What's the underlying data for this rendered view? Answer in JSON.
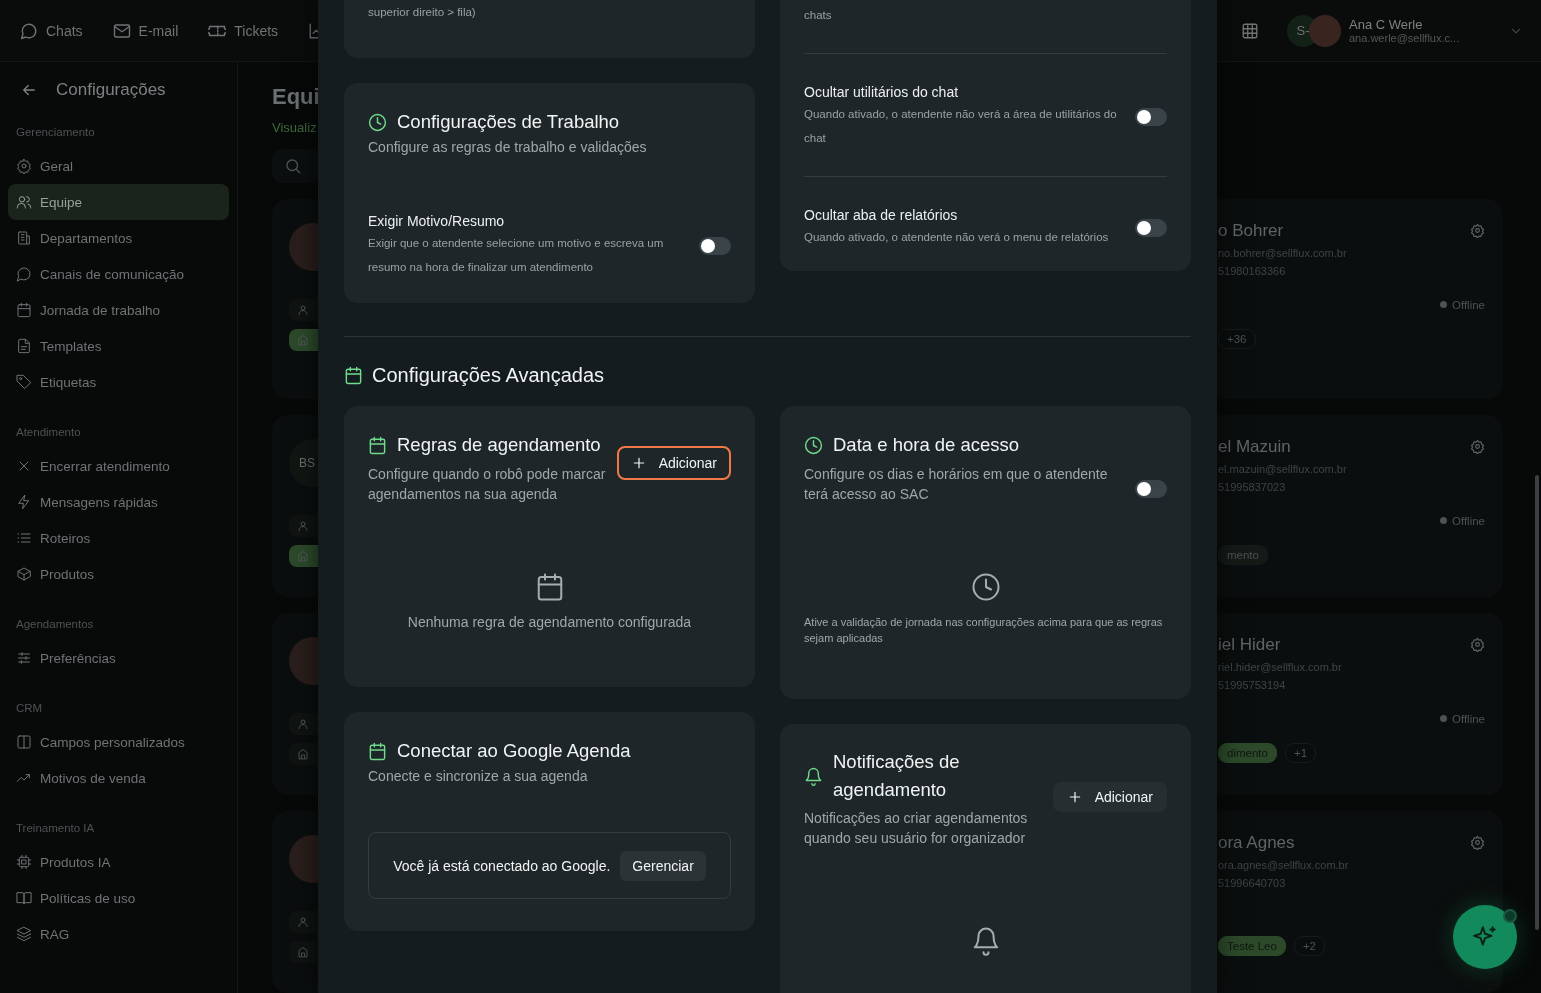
{
  "top_nav": [
    {
      "label": "Chats"
    },
    {
      "label": "E-mail"
    },
    {
      "label": "Tickets"
    }
  ],
  "account": {
    "initials": "S-",
    "name": "Ana C Werle",
    "email": "ana.werle@sellflux.c..."
  },
  "sidebar": {
    "title": "Configurações",
    "sections": [
      {
        "heading": "Gerenciamento",
        "items": [
          {
            "label": "Geral",
            "selected": false
          },
          {
            "label": "Equipe",
            "selected": true
          },
          {
            "label": "Departamentos",
            "selected": false
          },
          {
            "label": "Canais de comunicação",
            "selected": false
          },
          {
            "label": "Jornada de trabalho",
            "selected": false
          },
          {
            "label": "Templates",
            "selected": false
          },
          {
            "label": "Etiquetas",
            "selected": false
          }
        ]
      },
      {
        "heading": "Atendimento",
        "items": [
          {
            "label": "Encerrar atendimento",
            "selected": false
          },
          {
            "label": "Mensagens rápidas",
            "selected": false
          },
          {
            "label": "Roteiros",
            "selected": false
          },
          {
            "label": "Produtos",
            "selected": false
          }
        ]
      },
      {
        "heading": "Agendamentos",
        "items": [
          {
            "label": "Preferências",
            "selected": false
          }
        ]
      },
      {
        "heading": "CRM",
        "items": [
          {
            "label": "Campos personalizados",
            "selected": false
          },
          {
            "label": "Motivos de venda",
            "selected": false
          }
        ]
      },
      {
        "heading": "Treinamento IA",
        "items": [
          {
            "label": "Produtos IA",
            "selected": false
          },
          {
            "label": "Políticas de uso",
            "selected": false
          },
          {
            "label": "RAG",
            "selected": false
          }
        ]
      }
    ]
  },
  "page": {
    "title": "Equi",
    "subtitle": "Visualiz"
  },
  "team_cards_left": [
    {
      "kind": "photo",
      "chip": {
        "color": "#2c4a2a"
      }
    },
    {
      "kind": "initials",
      "initials": "BS",
      "chip": {
        "color": "#2c4a2a"
      }
    },
    {
      "kind": "photo",
      "chip": {
        "color": "#0f1312"
      }
    },
    {
      "kind": "photo",
      "chip": {
        "color": "#0f1312"
      }
    }
  ],
  "team_cards_right": [
    {
      "name": "o Bohrer",
      "email": "no.bohrer@sellflux.com.br",
      "phone": "51980163366",
      "status": "Offline",
      "tags": [
        {
          "label": "+36",
          "kind": "plain"
        }
      ]
    },
    {
      "name": "el Mazuin",
      "email": "el.mazuin@sellflux.com.br",
      "phone": "51995837023",
      "status": "Offline",
      "tags": [
        {
          "label": "mento",
          "kind": "muted"
        }
      ]
    },
    {
      "name": "iel Hider",
      "email": "riel.hider@sellflux.com.br",
      "phone": "51995753194",
      "status": "Offline",
      "tags": [
        {
          "label": "dimento",
          "kind": "highlight"
        },
        {
          "label": "+1",
          "kind": "plain"
        }
      ]
    },
    {
      "name": "ora Agnes",
      "email": "ora.agnes@sellflux.com.br",
      "phone": "51996640703",
      "tags": [
        {
          "label": "Teste Leo",
          "kind": "highlight"
        },
        {
          "label": "+2",
          "kind": "plain"
        }
      ]
    }
  ],
  "modal": {
    "fragment_left": "superior direito > fila)",
    "fragment_right": "chats",
    "right_settings": [
      {
        "title": "Ocultar utilitários do chat",
        "description": "Quando ativado, o atendente não verá a área de utilitários do chat",
        "on": false
      },
      {
        "title": "Ocultar aba de relatórios",
        "description": "Quando ativado, o atendente não verá o menu de relatórios",
        "on": false
      }
    ],
    "work": {
      "title": "Configurações de Trabalho",
      "subtitle": "Configure as regras de trabalho e validações",
      "settings": [
        {
          "title": "Exigir Motivo/Resumo",
          "description": "Exigir que o atendente selecione um motivo e escreva um resumo na hora de finalizar um atendimento",
          "on": false
        }
      ]
    },
    "advanced": {
      "title": "Configurações Avançadas",
      "rules": {
        "title": "Regras de agendamento",
        "description": "Configure quando o robô pode marcar agendamentos na sua agenda",
        "button": {
          "label": "Adicionar",
          "focused": true
        },
        "empty_text": "Nenhuma regra de agendamento configurada"
      },
      "google": {
        "title": "Conectar ao Google Agenda",
        "description": "Conecte e sincronize a sua agenda",
        "status": "Você já está conectado ao Google.",
        "button": "Gerenciar"
      },
      "access": {
        "title": "Data e hora de acesso",
        "description": "Configure os dias e horários em que o atendente terá acesso ao SAC",
        "on": false,
        "notice": "Ative a validação de jornada nas configurações acima para que as regras sejam aplicadas"
      },
      "notifications": {
        "title": "Notificações de agendamento",
        "description": "Notificações ao criar agendamentos quando seu usuário for organizador",
        "button": {
          "label": "Adicionar",
          "focused": false
        }
      }
    }
  }
}
